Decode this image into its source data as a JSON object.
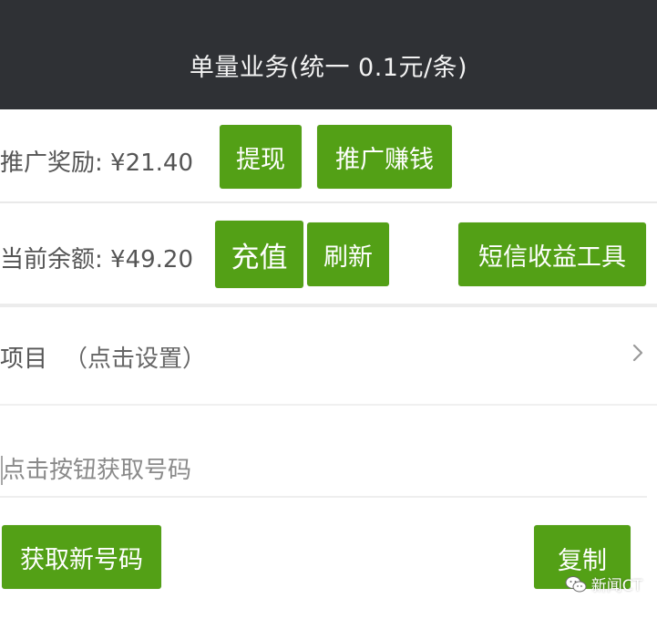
{
  "header": {
    "title": "单量业务(统一 0.1元/条)"
  },
  "promo": {
    "label": "推广奖励: ¥21.40",
    "withdraw_label": "提现",
    "earn_label": "推广赚钱"
  },
  "balance": {
    "label": "当前余额: ¥49.20",
    "recharge_label": "充值",
    "refresh_label": "刷新",
    "sms_tools_label": "短信收益工具"
  },
  "project": {
    "label": "项目",
    "hint": "（点击设置）",
    "chevron_icon": "chevron-right-icon"
  },
  "phone": {
    "placeholder": "点击按钮获取号码",
    "value": ""
  },
  "actions": {
    "get_number_label": "获取新号码",
    "copy_label": "复制"
  },
  "watermark": {
    "icon": "wechat-icon",
    "text": "新闻CT"
  },
  "colors": {
    "header_bg": "#2f3135",
    "accent_green": "#53a016",
    "text": "#555555"
  }
}
